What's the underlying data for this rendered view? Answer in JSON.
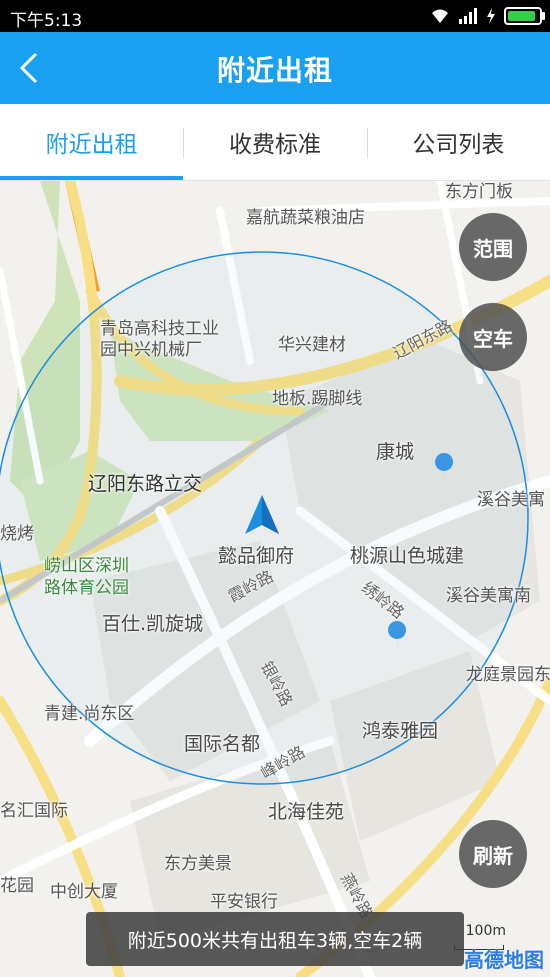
{
  "status_bar": {
    "time": "下午5:13"
  },
  "header": {
    "title": "附近出租",
    "back_icon": "chevron-left-icon"
  },
  "tabs": [
    {
      "label": "附近出租",
      "active": true
    },
    {
      "label": "收费标准",
      "active": false
    },
    {
      "label": "公司列表",
      "active": false
    }
  ],
  "map": {
    "pois": {
      "jiahang": "嘉航蔬菜粮油店",
      "dongfang_top": "东方门板",
      "qingdao_gaoke_1": "青岛高科技工业",
      "qingdao_gaoke_2": "园中兴机械厂",
      "huaxing": "华兴建材",
      "diban": "地板.踢脚线",
      "kangcheng": "康城",
      "xigu_1": "溪谷美寓",
      "liaoyang_interchange": "辽阳东路立交",
      "yipin": "懿品御府",
      "taoyuan": "桃源山色城建",
      "shaokao": "烧烤",
      "laoshan_1": "崂山区深圳",
      "laoshan_2": "路体育公园",
      "baishi": "百仕.凯旋城",
      "xigu_nan": "溪谷美寓南",
      "longting": "龙庭景园东",
      "qingjian": "青建.尚东区",
      "guoji": "国际名都",
      "hongtai": "鸿泰雅园",
      "huihui": "名汇国际",
      "beihai": "北海佳苑",
      "dongfang_mei": "东方美景",
      "huayuan": "花园",
      "zhongchuang": "中创大厦",
      "pingan": "平安银行"
    },
    "roads": {
      "liaoyang_dong": "辽阳东路",
      "xialing": "霞岭路",
      "xiuling": "绣岭路",
      "yinling": "银岭路",
      "fengling": "峰岭路",
      "yanling": "燕岭路"
    },
    "scale_label": "100m",
    "logo": "高德地图"
  },
  "buttons": {
    "range": "范围",
    "empty_car": "空车",
    "refresh": "刷新"
  },
  "toast": "附近500米共有出租车3辆,空车2辆"
}
